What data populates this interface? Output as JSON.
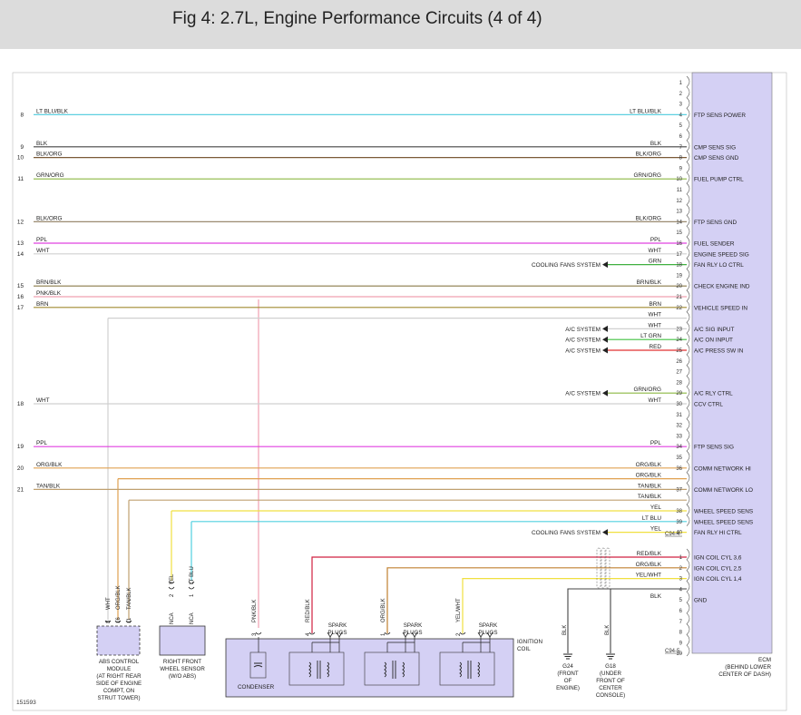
{
  "title": "Fig 4: 2.7L, Engine Performance Circuits (4 of 4)",
  "figure_id": "151593",
  "ecm": {
    "connector_top": "C94-4",
    "connector_bottom": "C94-5",
    "label": [
      "ECM",
      "(BEHIND LOWER",
      "CENTER OF DASH)"
    ]
  },
  "pins_top": [
    {
      "pin": "1",
      "func": "",
      "wire": "",
      "left": "",
      "left_num": "",
      "color": ""
    },
    {
      "pin": "2",
      "func": "",
      "wire": "",
      "left": "",
      "left_num": "",
      "color": ""
    },
    {
      "pin": "3",
      "func": "",
      "wire": "",
      "left": "",
      "left_num": "",
      "color": ""
    },
    {
      "pin": "4",
      "func": "FTP SENS POWER",
      "wire": "LT BLU/BLK",
      "left": "LT BLU/BLK",
      "left_num": "8",
      "color": "#5fd0e0"
    },
    {
      "pin": "5",
      "func": "",
      "wire": "",
      "left": "",
      "left_num": "",
      "color": ""
    },
    {
      "pin": "6",
      "func": "",
      "wire": "",
      "left": "",
      "left_num": "",
      "color": ""
    },
    {
      "pin": "7",
      "func": "CMP SENS SIG",
      "wire": "BLK",
      "left": "BLK",
      "left_num": "9",
      "color": "#444444"
    },
    {
      "pin": "8",
      "func": "CMP SENS GND",
      "wire": "BLK/ORG",
      "left": "BLK/ORG",
      "left_num": "10",
      "color": "#7a5a38"
    },
    {
      "pin": "9",
      "func": "",
      "wire": "",
      "left": "",
      "left_num": "",
      "color": ""
    },
    {
      "pin": "10",
      "func": "FUEL PUMP CTRL",
      "wire": "GRN/ORG",
      "left": "GRN/ORG",
      "left_num": "11",
      "color": "#8cb840"
    },
    {
      "pin": "11",
      "func": "",
      "wire": "",
      "left": "",
      "left_num": "",
      "color": ""
    },
    {
      "pin": "12",
      "func": "",
      "wire": "",
      "left": "",
      "left_num": "",
      "color": ""
    },
    {
      "pin": "13",
      "func": "",
      "wire": "",
      "left": "",
      "left_num": "",
      "color": ""
    },
    {
      "pin": "14",
      "func": "FTP SENS GND",
      "wire": "BLK/ORG",
      "left": "BLK/ORG",
      "left_num": "12",
      "color": "#9a8a70"
    },
    {
      "pin": "15",
      "func": "",
      "wire": "",
      "left": "",
      "left_num": "",
      "color": ""
    },
    {
      "pin": "16",
      "func": "FUEL SENDER",
      "wire": "PPL",
      "left": "PPL",
      "left_num": "13",
      "color": "#e040e0"
    },
    {
      "pin": "17",
      "func": "ENGINE SPEED SIG",
      "wire": "WHT",
      "left": "WHT",
      "left_num": "14",
      "color": "#d0d0d0"
    },
    {
      "pin": "18",
      "func": "FAN RLY LO CTRL",
      "wire": "GRN",
      "left": "",
      "left_num": "",
      "color": "#40b040",
      "ext": "COOLING FANS SYSTEM"
    },
    {
      "pin": "19",
      "func": "",
      "wire": "",
      "left": "",
      "left_num": "",
      "color": ""
    },
    {
      "pin": "20",
      "func": "CHECK ENGINE IND",
      "wire": "BRN/BLK",
      "left": "BRN/BLK",
      "left_num": "15",
      "color": "#8a7a48"
    },
    {
      "pin": "21",
      "func": "",
      "wire": "",
      "left": "PNK/BLK",
      "left_num": "16",
      "color": "#f0a0b0"
    },
    {
      "pin": "22",
      "func": "VEHICLE SPEED IN",
      "wire": "BRN",
      "left": "BRN",
      "left_num": "17",
      "color": "#a08a30"
    },
    {
      "pin": "",
      "func": "",
      "wire": "WHT",
      "left": "",
      "left_num": "",
      "color": "#d0d0d0"
    },
    {
      "pin": "23",
      "func": "A/C SIG INPUT",
      "wire": "WHT",
      "left": "",
      "left_num": "",
      "color": "#d0d0d0",
      "ext": "A/C SYSTEM"
    },
    {
      "pin": "24",
      "func": "A/C ON INPUT",
      "wire": "LT GRN",
      "left": "",
      "left_num": "",
      "color": "#40c040",
      "ext": "A/C SYSTEM"
    },
    {
      "pin": "25",
      "func": "A/C PRESS SW IN",
      "wire": "RED",
      "left": "",
      "left_num": "",
      "color": "#e03030",
      "ext": "A/C SYSTEM"
    },
    {
      "pin": "26",
      "func": "",
      "wire": "",
      "left": "",
      "left_num": "",
      "color": ""
    },
    {
      "pin": "27",
      "func": "",
      "wire": "",
      "left": "",
      "left_num": "",
      "color": ""
    },
    {
      "pin": "28",
      "func": "",
      "wire": "",
      "left": "",
      "left_num": "",
      "color": ""
    },
    {
      "pin": "29",
      "func": "A/C RLY CTRL",
      "wire": "GRN/ORG",
      "left": "",
      "left_num": "",
      "color": "#8cb840",
      "ext": "A/C SYSTEM"
    },
    {
      "pin": "30",
      "func": "CCV CTRL",
      "wire": "WHT",
      "left": "WHT",
      "left_num": "18",
      "color": "#d0d0d0"
    },
    {
      "pin": "31",
      "func": "",
      "wire": "",
      "left": "",
      "left_num": "",
      "color": ""
    },
    {
      "pin": "32",
      "func": "",
      "wire": "",
      "left": "",
      "left_num": "",
      "color": ""
    },
    {
      "pin": "33",
      "func": "",
      "wire": "",
      "left": "",
      "left_num": "",
      "color": ""
    },
    {
      "pin": "34",
      "func": "FTP SENS SIG",
      "wire": "PPL",
      "left": "PPL",
      "left_num": "19",
      "color": "#e040e0"
    },
    {
      "pin": "35",
      "func": "",
      "wire": "",
      "left": "",
      "left_num": "",
      "color": ""
    },
    {
      "pin": "36",
      "func": "COMM NETWORK HI",
      "wire": "ORG/BLK",
      "left": "ORG/BLK",
      "left_num": "20",
      "color": "#e0a050"
    },
    {
      "pin": "",
      "func": "",
      "wire": "ORG/BLK",
      "left": "",
      "left_num": "",
      "color": "#e0a050"
    },
    {
      "pin": "37",
      "func": "COMM NETWORK LO",
      "wire": "TAN/BLK",
      "left": "TAN/BLK",
      "left_num": "21",
      "color": "#c0a070"
    },
    {
      "pin": "",
      "func": "",
      "wire": "TAN/BLK",
      "left": "",
      "left_num": "",
      "color": "#c0a070"
    },
    {
      "pin": "38",
      "func": "WHEEL SPEED SENS",
      "wire": "YEL",
      "left": "",
      "left_num": "",
      "color": "#f0e040"
    },
    {
      "pin": "39",
      "func": "WHEEL SPEED SENS",
      "wire": "LT BLU",
      "left": "",
      "left_num": "",
      "color": "#50d0e0"
    },
    {
      "pin": "40",
      "func": "FAN RLY HI CTRL",
      "wire": "YEL",
      "left": "",
      "left_num": "",
      "color": "#f0e040",
      "ext": "COOLING FANS SYSTEM"
    }
  ],
  "pins_bottom": [
    {
      "pin": "1",
      "func": "IGN COIL CYL 3,6",
      "wire": "RED/BLK",
      "color": "#d02040"
    },
    {
      "pin": "2",
      "func": "IGN COIL CYL 2,5",
      "wire": "ORG/BLK",
      "color": "#c08030"
    },
    {
      "pin": "3",
      "func": "IGN COIL CYL 1,4",
      "wire": "YEL/WHT",
      "color": "#f0e040"
    },
    {
      "pin": "4",
      "func": "",
      "wire": "",
      "color": ""
    },
    {
      "pin": "5",
      "func": "GND",
      "wire": "BLK",
      "color": "#444444"
    },
    {
      "pin": "6",
      "func": "",
      "wire": "",
      "color": ""
    },
    {
      "pin": "7",
      "func": "",
      "wire": "",
      "color": ""
    },
    {
      "pin": "8",
      "func": "",
      "wire": "",
      "color": ""
    },
    {
      "pin": "9",
      "func": "",
      "wire": "",
      "color": ""
    },
    {
      "pin": "10",
      "func": "",
      "wire": "",
      "color": ""
    }
  ],
  "abs": {
    "pins": [
      {
        "n": "3",
        "w": "WHT"
      },
      {
        "n": "16",
        "w": "ORG/BLK"
      },
      {
        "n": "11",
        "w": "TAN/BLK"
      }
    ],
    "label": [
      "ABS CONTROL",
      "MODULE",
      "(AT RIGHT REAR",
      "SIDE OF ENGINE",
      "COMPT, ON",
      "STRUT TOWER)"
    ]
  },
  "wheel_sensor": {
    "pins": [
      {
        "n": "2",
        "w": "YEL",
        "nca": "NCA"
      },
      {
        "n": "1",
        "w": "LT BLU",
        "nca": "NCA"
      }
    ],
    "label": [
      "RIGHT FRONT",
      "WHEEL SENSOR",
      "(W/O ABS)"
    ]
  },
  "ignition": {
    "label": [
      "IGNITION",
      "COIL"
    ],
    "condenser": "CONDENSER",
    "pins": [
      {
        "n": "3",
        "w": "PNK/BLK"
      },
      {
        "n": "4",
        "w": "RED/BLK"
      },
      {
        "n": "1",
        "w": "ORG/BLK"
      },
      {
        "n": "2",
        "w": "YEL/WHT"
      }
    ],
    "spark": [
      "SPARK",
      "PLUGS"
    ]
  },
  "grounds": [
    {
      "wire": "BLK",
      "label": [
        "G24",
        "(FRONT",
        "OF",
        "ENGINE)"
      ]
    },
    {
      "wire": "BLK",
      "label": [
        "G18",
        "(UNDER",
        "FRONT OF",
        "CENTER",
        "CONSOLE)"
      ]
    }
  ]
}
